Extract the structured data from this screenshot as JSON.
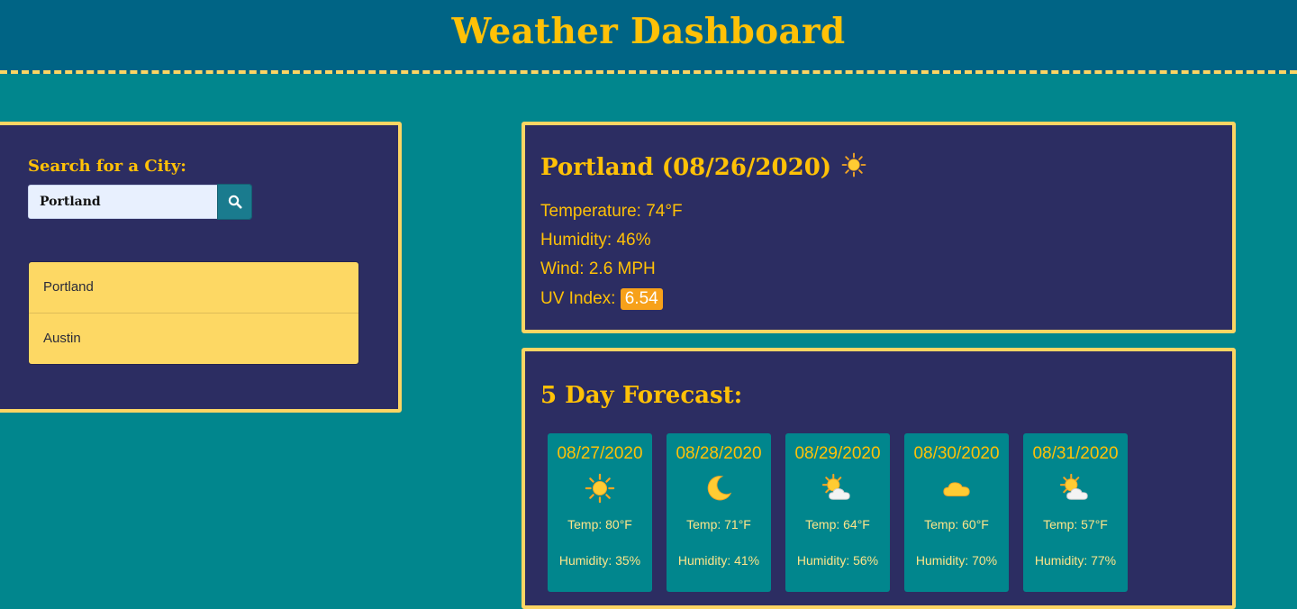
{
  "header": {
    "title": "Weather Dashboard"
  },
  "search": {
    "label": "Search for a City:",
    "value": "Portland",
    "placeholder": "",
    "button_icon": "search-icon"
  },
  "history": [
    {
      "label": "Portland"
    },
    {
      "label": "Austin"
    }
  ],
  "current": {
    "title": "Portland (08/26/2020)",
    "icon": "sun-icon",
    "temperature": "Temperature: 74°F",
    "humidity": "Humidity: 46%",
    "wind": "Wind: 2.6 MPH",
    "uv_label": "UV Index:",
    "uv_value": "6.54",
    "uv_color": "#f7a11a"
  },
  "forecast": {
    "title": "5 Day Forecast:",
    "days": [
      {
        "date": "08/27/2020",
        "icon": "sun-icon",
        "temp": "Temp: 80°F",
        "humidity": "Humidity: 35%"
      },
      {
        "date": "08/28/2020",
        "icon": "moon-icon",
        "temp": "Temp: 71°F",
        "humidity": "Humidity: 41%"
      },
      {
        "date": "08/29/2020",
        "icon": "partly-cloudy-icon",
        "temp": "Temp: 64°F",
        "humidity": "Humidity: 56%"
      },
      {
        "date": "08/30/2020",
        "icon": "cloud-icon",
        "temp": "Temp: 60°F",
        "humidity": "Humidity: 70%"
      },
      {
        "date": "08/31/2020",
        "icon": "partly-cloudy-icon",
        "temp": "Temp: 57°F",
        "humidity": "Humidity: 77%"
      }
    ]
  },
  "colors": {
    "background": "#01868d",
    "header": "#006485",
    "panel": "#2c2d62",
    "accent": "#ffc107",
    "border": "#fcd563",
    "history_item": "#fdd864"
  }
}
